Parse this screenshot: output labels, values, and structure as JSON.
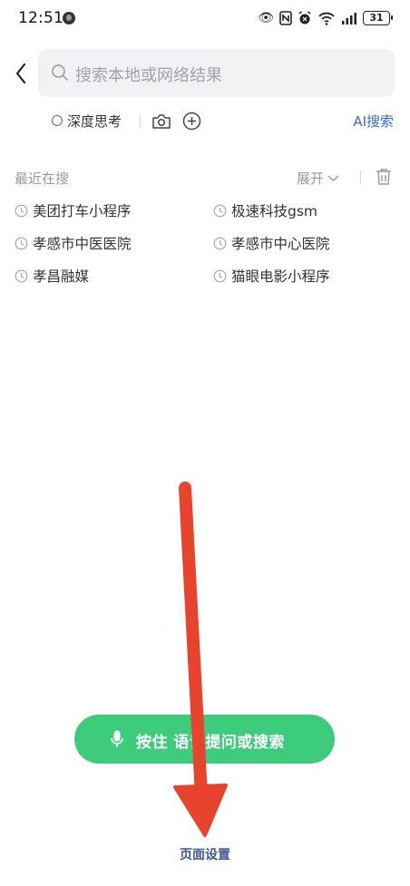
{
  "status_bar": {
    "time": "12:51",
    "battery": "31",
    "icons": [
      "eye-icon",
      "nfc-icon",
      "alarm-icon",
      "wifi-icon",
      "signal-icon",
      "battery-icon"
    ]
  },
  "search": {
    "placeholder": "搜索本地或网络结果"
  },
  "options": {
    "deep_think": "深度思考",
    "ai_search": "AI搜索"
  },
  "recent": {
    "title": "最近在搜",
    "expand": "展开",
    "items": [
      {
        "label": "美团打车小程序"
      },
      {
        "label": "极速科技gsm"
      },
      {
        "label": "孝感市中医医院"
      },
      {
        "label": "孝感市中心医院"
      },
      {
        "label": "孝昌融媒"
      },
      {
        "label": "猫眼电影小程序"
      }
    ]
  },
  "voice": {
    "label": "按住 语音提问或搜索"
  },
  "footer": {
    "page_settings": "页面设置"
  },
  "colors": {
    "accent_blue": "#3b67c8",
    "voice_green": "#3ccc7c",
    "annotation_red": "#e8432d"
  }
}
